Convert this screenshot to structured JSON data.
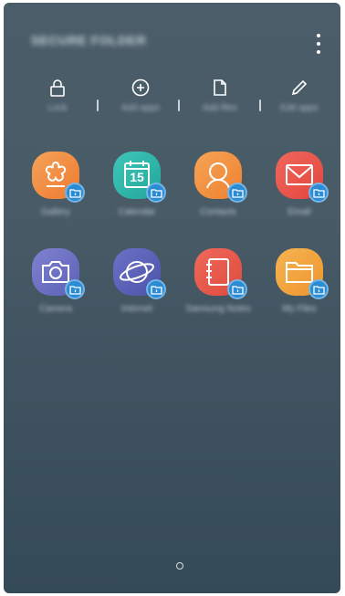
{
  "header": {
    "title": "SECURE FOLDER",
    "more_icon": "more-vert-icon"
  },
  "actions": [
    {
      "label": "Lock",
      "icon": "lock-icon"
    },
    {
      "label": "Add apps",
      "icon": "add-circle-icon"
    },
    {
      "label": "Add files",
      "icon": "file-icon"
    },
    {
      "label": "Edit apps",
      "icon": "pencil-icon"
    }
  ],
  "apps": [
    {
      "label": "Gallery",
      "icon": "gallery-icon",
      "color": "#f08a2e"
    },
    {
      "label": "Calendar",
      "icon": "calendar-icon",
      "color": "#2bb3a8",
      "calendar_day": "15"
    },
    {
      "label": "Contacts",
      "icon": "contacts-icon",
      "color": "#f08a2e"
    },
    {
      "label": "Email",
      "icon": "email-icon",
      "color": "#e8514a"
    },
    {
      "label": "Camera",
      "icon": "camera-icon",
      "color": "#6b6fc2"
    },
    {
      "label": "Internet",
      "icon": "internet-icon",
      "color": "#5a5fb8"
    },
    {
      "label": "Samsung Notes",
      "icon": "notes-icon",
      "color": "#e8514a"
    },
    {
      "label": "My Files",
      "icon": "folder-icon",
      "color": "#f2a23a"
    }
  ],
  "secure_badge_icon": "secure-folder-badge-icon",
  "nav": {
    "home_icon": "home-circle-icon"
  }
}
